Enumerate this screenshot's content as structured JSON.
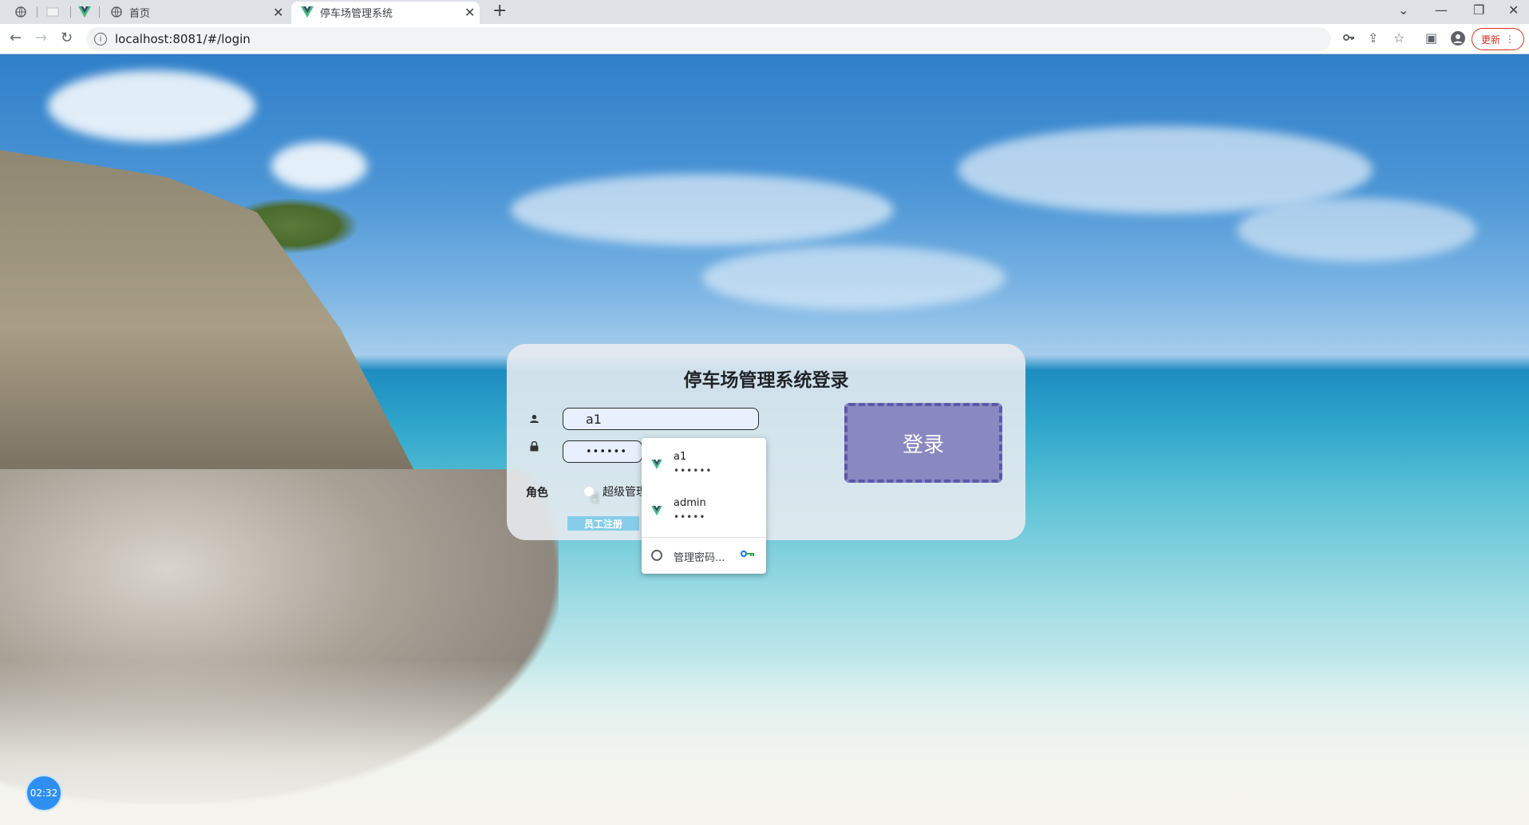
{
  "browser": {
    "tabs": [
      {
        "title": ""
      },
      {
        "title": ""
      },
      {
        "title": ""
      },
      {
        "title": "首页"
      },
      {
        "title": "停车场管理系统"
      }
    ],
    "url": "localhost:8081/#/login",
    "update_label": "更新",
    "icons": [
      "back-icon",
      "forward-icon",
      "reload-icon",
      "info-icon",
      "key-icon",
      "share-icon",
      "star-icon",
      "sidebar-icon",
      "profile-icon",
      "menu-icon"
    ]
  },
  "login": {
    "title": "停车场管理系统登录",
    "username_value": "a1",
    "password_value": "••••••",
    "role_label": "角色",
    "role_option": "超级管理",
    "register_label": "员工注册",
    "login_label": "登录"
  },
  "autofill": {
    "items": [
      {
        "user": "a1",
        "password": "••••••"
      },
      {
        "user": "admin",
        "password": "•••••"
      }
    ],
    "manage_label": "管理密码..."
  },
  "recording_timer": "02:32",
  "colors": {
    "login_button": "#8988c0",
    "register_button": "#87cdea",
    "update_button": "#d93025"
  }
}
